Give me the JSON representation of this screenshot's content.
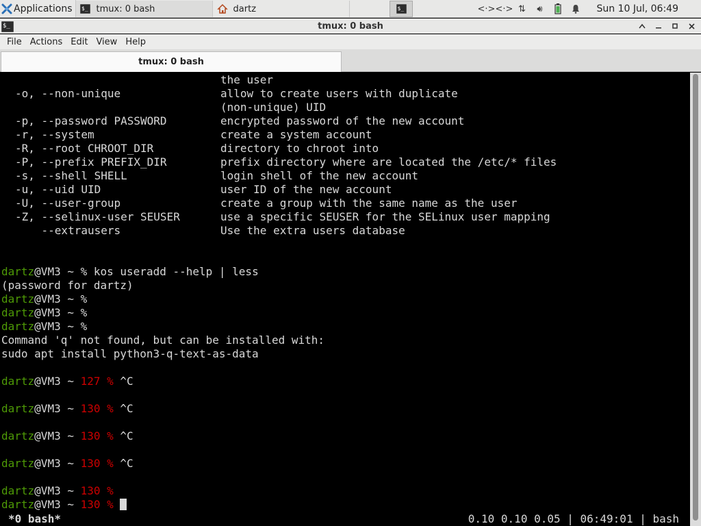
{
  "panel": {
    "applications_label": "Applications",
    "tasks": [
      {
        "label": "tmux: 0 bash"
      },
      {
        "label": "dartz"
      }
    ],
    "clock": "Sun 10 Jul, 06:49"
  },
  "window": {
    "title": "tmux: 0 bash"
  },
  "menubar": {
    "items": [
      "File",
      "Actions",
      "Edit",
      "View",
      "Help"
    ]
  },
  "tabs": [
    {
      "label": "tmux: 0 bash"
    }
  ],
  "terminal": {
    "help_continuation": "the user",
    "options": [
      {
        "flag": "-o, --non-unique",
        "desc": "allow to create users with duplicate"
      },
      {
        "flag": "",
        "desc": "(non-unique) UID"
      },
      {
        "flag": "-p, --password PASSWORD",
        "desc": "encrypted password of the new account"
      },
      {
        "flag": "-r, --system",
        "desc": "create a system account"
      },
      {
        "flag": "-R, --root CHROOT_DIR",
        "desc": "directory to chroot into"
      },
      {
        "flag": "-P, --prefix PREFIX_DIR",
        "desc": "prefix directory where are located the /etc/* files"
      },
      {
        "flag": "-s, --shell SHELL",
        "desc": "login shell of the new account"
      },
      {
        "flag": "-u, --uid UID",
        "desc": "user ID of the new account"
      },
      {
        "flag": "-U, --user-group",
        "desc": "create a group with the same name as the user"
      },
      {
        "flag": "-Z, --selinux-user SEUSER",
        "desc": "use a specific SEUSER for the SELinux user mapping"
      },
      {
        "flag": "    --extrausers",
        "desc": "Use the extra users database"
      }
    ],
    "prompt_user": "dartz",
    "prompt_host": "@VM3 ~ ",
    "command": "% kos useradd --help | less",
    "password_prompt": "(password for dartz)",
    "plain_prompt": "%",
    "not_found_1": "Command 'q' not found, but can be installed with:",
    "not_found_2": "sudo apt install python3-q-text-as-data",
    "prompts": [
      {
        "code": "127 %",
        "input": " ^C"
      },
      {
        "code": "130 %",
        "input": " ^C"
      },
      {
        "code": "130 %",
        "input": " ^C"
      },
      {
        "code": "130 %",
        "input": " ^C"
      },
      {
        "code": "130 %",
        "input": ""
      },
      {
        "code": "130 %",
        "input": " "
      }
    ]
  },
  "tmux_status": {
    "window": "*0 bash*",
    "right": "0.10 0.10 0.05 | 06:49:01 | bash"
  },
  "colors": {
    "prompt_green": "#4e9a06",
    "exit_code_red": "#cc0000",
    "terminal_bg": "#000000",
    "terminal_fg": "#d8d8d8"
  }
}
